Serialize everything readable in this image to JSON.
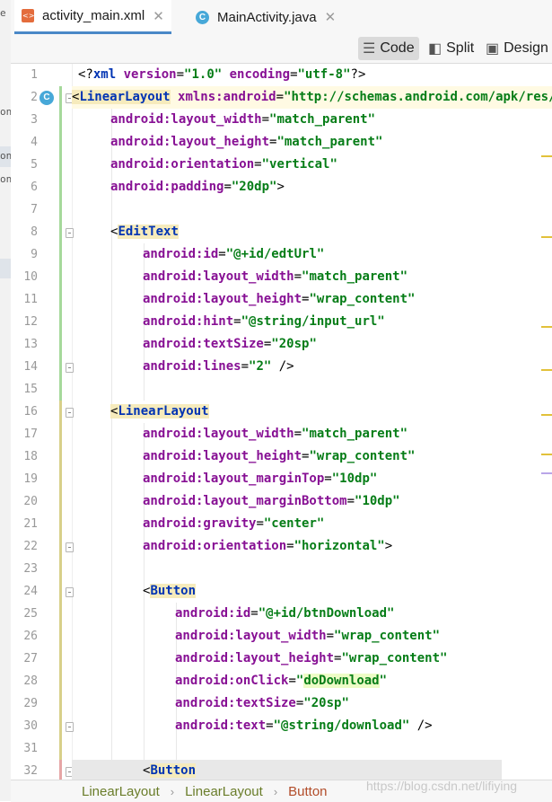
{
  "tabs": [
    {
      "label": "activity_main.xml",
      "icon": "xml-file-icon",
      "active": true
    },
    {
      "label": "MainActivity.java",
      "icon": "java-class-icon",
      "active": false
    }
  ],
  "close_glyph": "✕",
  "view_modes": {
    "code": "Code",
    "split": "Split",
    "design": "Design",
    "selected": "Code"
  },
  "left_strip_fragments": [
    "e",
    "on",
    "on",
    "on"
  ],
  "gutter_class_badge": "C",
  "line_numbers": [
    "1",
    "2",
    "3",
    "4",
    "5",
    "6",
    "7",
    "8",
    "9",
    "10",
    "11",
    "12",
    "13",
    "14",
    "15",
    "16",
    "17",
    "18",
    "19",
    "20",
    "21",
    "22",
    "23",
    "24",
    "25",
    "26",
    "27",
    "28",
    "29",
    "30",
    "31",
    "32"
  ],
  "code": {
    "l1": {
      "a": "<?",
      "b": "xml ",
      "c": "version",
      "d": "=",
      "e": "\"1.0\"",
      "f": " ",
      "g": "encoding",
      "h": "=",
      "i": "\"utf-8\"",
      "j": "?>"
    },
    "l2": {
      "a": "<",
      "b": "LinearLayout",
      "c": " xmlns:",
      "d": "android",
      "e": "=",
      "f": "\"http://schemas.android.com/apk/res/android\""
    },
    "l3": {
      "a": "android:layout_width",
      "b": "=",
      "c": "\"match_parent\""
    },
    "l4": {
      "a": "android:layout_height",
      "b": "=",
      "c": "\"match_parent\""
    },
    "l5": {
      "a": "android:orientation",
      "b": "=",
      "c": "\"vertical\""
    },
    "l6": {
      "a": "android:padding",
      "b": "=",
      "c": "\"20dp\"",
      "d": ">"
    },
    "l8": {
      "a": "<",
      "b": "EditText"
    },
    "l9": {
      "a": "android:id",
      "b": "=",
      "c": "\"@+id/edtUrl\""
    },
    "l10": {
      "a": "android:layout_width",
      "b": "=",
      "c": "\"match_parent\""
    },
    "l11": {
      "a": "android:layout_height",
      "b": "=",
      "c": "\"wrap_content\""
    },
    "l12": {
      "a": "android:hint",
      "b": "=",
      "c": "\"@string/input_url\""
    },
    "l13": {
      "a": "android:textSize",
      "b": "=",
      "c": "\"20sp\""
    },
    "l14": {
      "a": "android:lines",
      "b": "=",
      "c": "\"2\"",
      "d": " />"
    },
    "l16": {
      "a": "<",
      "b": "LinearLayout"
    },
    "l17": {
      "a": "android:layout_width",
      "b": "=",
      "c": "\"match_parent\""
    },
    "l18": {
      "a": "android:layout_height",
      "b": "=",
      "c": "\"wrap_content\""
    },
    "l19": {
      "a": "android:layout_marginTop",
      "b": "=",
      "c": "\"10dp\""
    },
    "l20": {
      "a": "android:layout_marginBottom",
      "b": "=",
      "c": "\"10dp\""
    },
    "l21": {
      "a": "android:gravity",
      "b": "=",
      "c": "\"center\""
    },
    "l22": {
      "a": "android:orientation",
      "b": "=",
      "c": "\"horizontal\"",
      "d": ">"
    },
    "l24": {
      "a": "<",
      "b": "Button"
    },
    "l25": {
      "a": "android:id",
      "b": "=",
      "c": "\"@+id/btnDownload\""
    },
    "l26": {
      "a": "android:layout_width",
      "b": "=",
      "c": "\"wrap_content\""
    },
    "l27": {
      "a": "android:layout_height",
      "b": "=",
      "c": "\"wrap_content\""
    },
    "l28": {
      "a": "android:onClick",
      "b": "=",
      "c": "\"",
      "d": "doDownload",
      "e": "\""
    },
    "l29": {
      "a": "android:textSize",
      "b": "=",
      "c": "\"20sp\""
    },
    "l30": {
      "a": "android:text",
      "b": "=",
      "c": "\"@string/download\"",
      "d": " />"
    },
    "l32": {
      "a": "<",
      "b": "Button"
    }
  },
  "breadcrumb": [
    "LinearLayout",
    "LinearLayout",
    "Button"
  ],
  "breadcrumb_sep": "›",
  "watermark": "https://blog.csdn.net/lifiying",
  "colors": {
    "tag": "#0033b3",
    "attribute": "#871094",
    "value": "#067d17",
    "active_tab_underline": "#4a88c7",
    "change_bar_added": "#a6d99b",
    "change_bar_modified": "#d8d08a",
    "warning_marker": "#e2c13a"
  }
}
